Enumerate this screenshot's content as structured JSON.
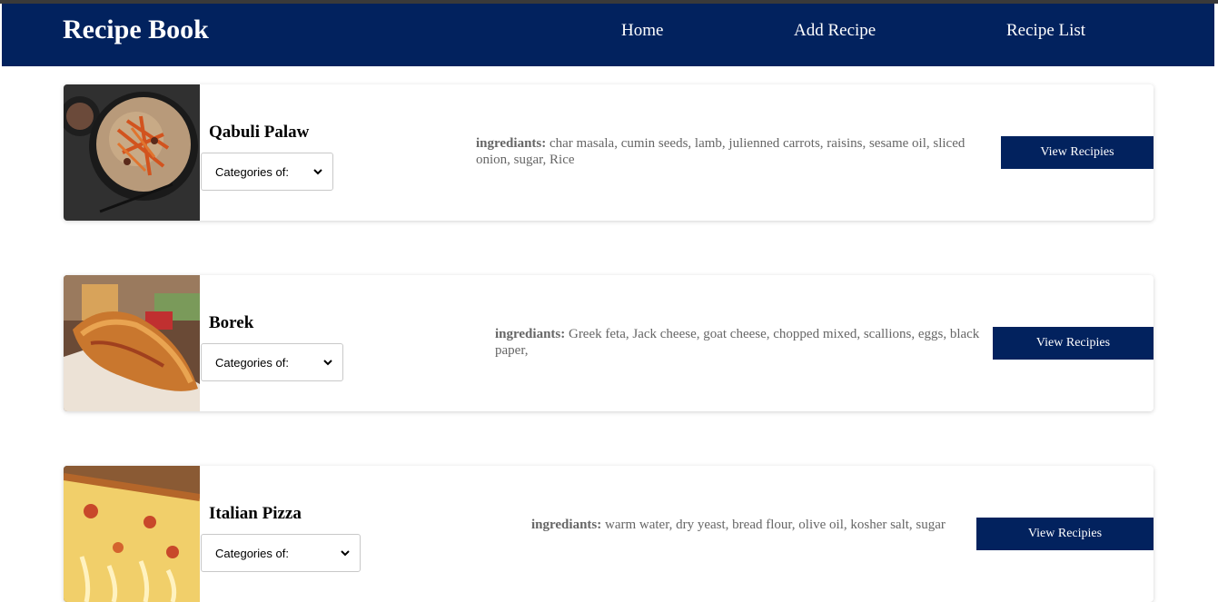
{
  "navbar": {
    "brand": "Recipe Book",
    "links": [
      "Home",
      "Add Recipe",
      "Recipe List"
    ]
  },
  "recipes": [
    {
      "title": "Qabuli Palaw",
      "category_select": "Categories of:",
      "ingredients_label": "ingrediants:",
      "ingredients": "char masala, cumin seeds, lamb, julienned carrots, raisins, sesame oil, sliced onion, sugar, Rice",
      "button": "View Recipies"
    },
    {
      "title": "Borek",
      "category_select": "Categories of:",
      "ingredients_label": "ingrediants:",
      "ingredients": "Greek feta, Jack cheese, goat cheese, chopped mixed, scallions, eggs, black paper,",
      "button": "View Recipies"
    },
    {
      "title": "Italian Pizza",
      "category_select": "Categories of:",
      "ingredients_label": "ingrediants:",
      "ingredients": "warm water, dry yeast, bread flour, olive oil, kosher salt, sugar",
      "button": "View Recipies"
    }
  ],
  "colors": {
    "navbar": "#02225e",
    "button": "#02225e",
    "ingredients_text": "#666666"
  }
}
